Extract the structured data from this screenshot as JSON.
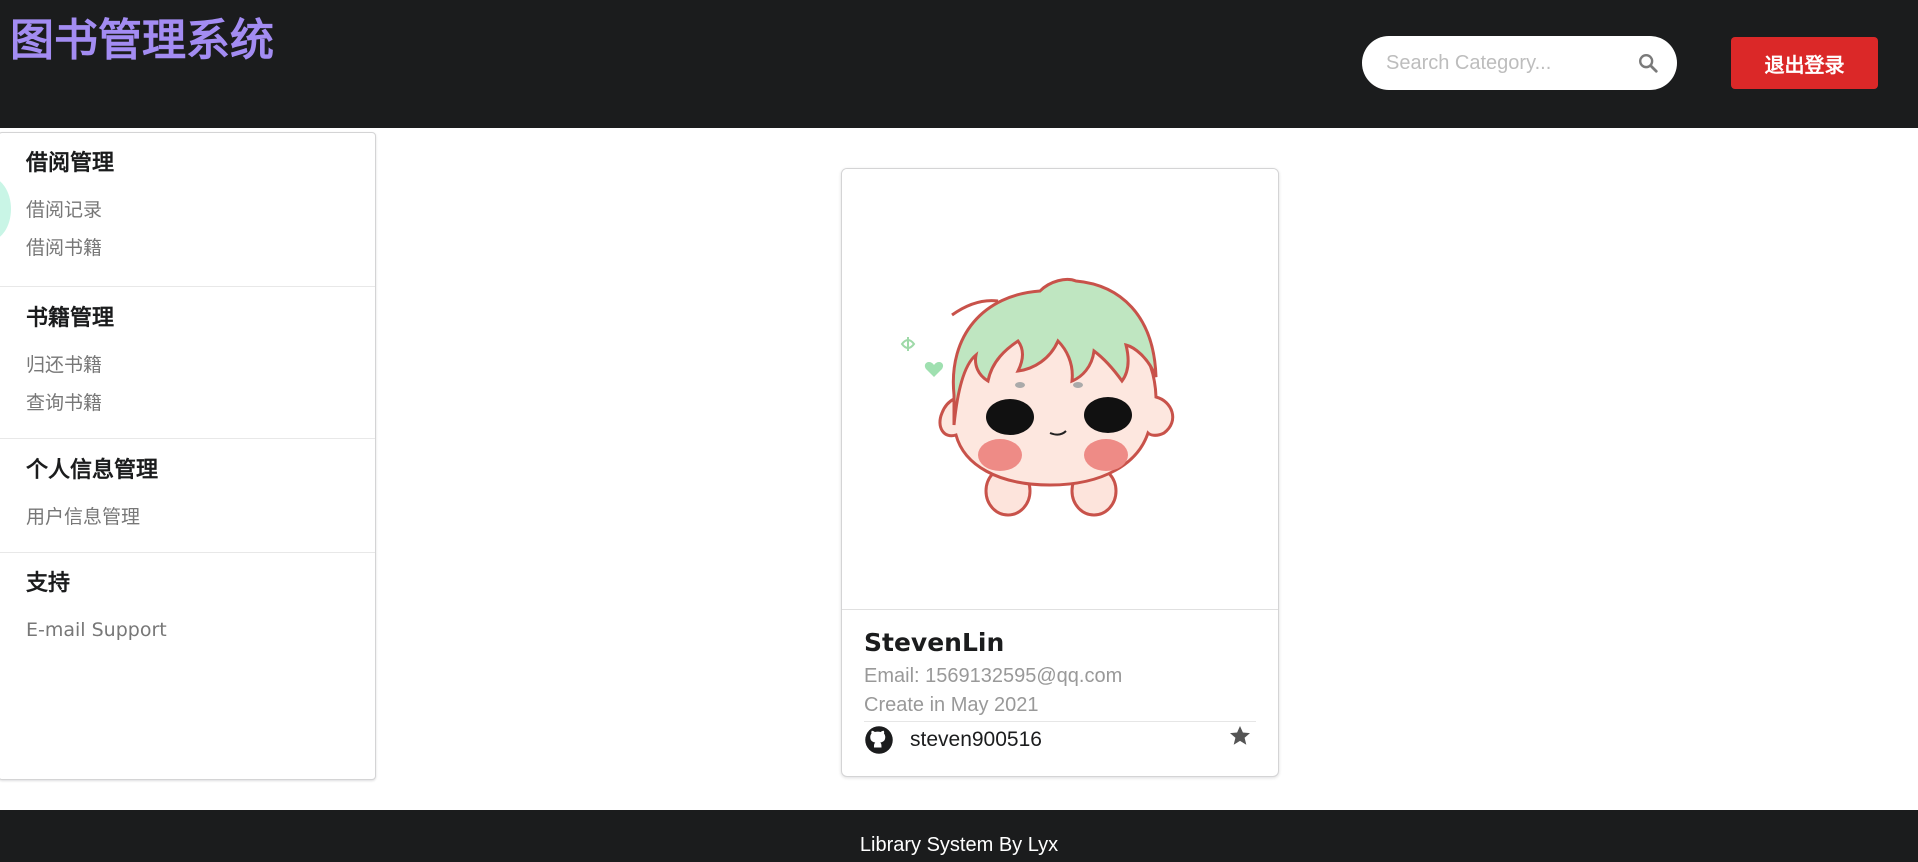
{
  "header": {
    "app_title": "图书管理系统",
    "search_placeholder": "Search Category...",
    "logout_label": "退出登录"
  },
  "sidebar": {
    "sections": [
      {
        "title": "借阅管理",
        "items": [
          "借阅记录",
          "借阅书籍"
        ]
      },
      {
        "title": "书籍管理",
        "items": [
          "归还书籍",
          "查询书籍"
        ]
      },
      {
        "title": "个人信息管理",
        "items": [
          "用户信息管理"
        ]
      },
      {
        "title": "支持",
        "items": [
          "E-mail Support"
        ]
      }
    ]
  },
  "profile_card": {
    "name": "StevenLin",
    "email": "Email: 1569132595@qq.com",
    "created": "Create in May 2021",
    "github_user": "steven900516"
  },
  "footer": {
    "text": "Library System By Lyx"
  },
  "colors": {
    "topbar": "#1b1c1d",
    "title": "#a38cf2",
    "logout": "#db2828"
  }
}
